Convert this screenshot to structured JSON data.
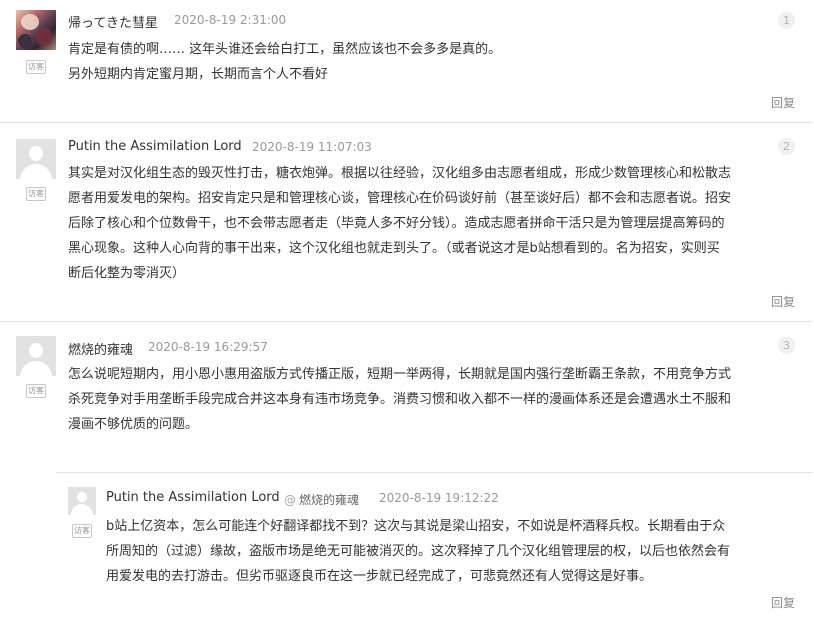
{
  "comments": [
    {
      "author": "帰ってきた彗星",
      "time": "2020-8-19 2:31:00",
      "floor": "1",
      "visitor_badge": "访客",
      "avatar": "anime-avatar-icon",
      "lines": [
        "肯定是有债的啊…… 这年头谁还会给白打工，虽然应该也不会多多是真的。",
        "另外短期内肯定蜜月期，长期而言个人不看好"
      ],
      "reply_label": "回复"
    },
    {
      "author": "Putin the Assimilation Lord",
      "time": "2020-8-19 11:07:03",
      "floor": "2",
      "visitor_badge": "访客",
      "avatar": "default-user-icon",
      "lines": [
        "其实是对汉化组生态的毁灭性打击，糖衣炮弹。根据以往经验，汉化组多由志愿者组成，形成少数管理核心和松散志",
        "愿者用爱发电的架构。招安肯定只是和管理核心谈，管理核心在价码谈好前（甚至谈好后）都不会和志愿者说。招安",
        "后除了核心和个位数骨干，也不会带志愿者走（毕竟人多不好分钱）。造成志愿者拼命干活只是为管理层提高筹码的",
        "黑心现象。这种人心向背的事干出来，这个汉化组也就走到头了。（或者说这才是b站想看到的。名为招安，实则买",
        "断后化整为零消灭）"
      ],
      "reply_label": "回复"
    },
    {
      "author": "燃烧的雍魂",
      "time": "2020-8-19 16:29:57",
      "floor": "3",
      "visitor_badge": "访客",
      "avatar": "default-user-icon",
      "lines": [
        "怎么说呢短期内，用小恩小惠用盗版方式传播正版，短期一举两得，长期就是国内强行垄断霸王条款，不用竞争方式",
        "杀死竞争对手用垄断手段完成合并这本身有违市场竞争。消费习惯和收入都不一样的漫画体系还是会遭遇水土不服和",
        "漫画不够优质的问题。"
      ],
      "reply": {
        "author": "Putin the Assimilation Lord",
        "reply_to_symbol": "@",
        "reply_to": "燃烧的雍魂",
        "time": "2020-8-19 19:12:22",
        "visitor_badge": "访客",
        "avatar": "default-user-icon",
        "lines": [
          "b站上亿资本，怎么可能连个好翻译都找不到？这次与其说是梁山招安，不如说是杯酒释兵权。长期看由于众",
          "所周知的（过滤）缘故，盗版市场是绝无可能被消灭的。这次释掉了几个汉化组管理层的权，以后也依然会有",
          "用爱发电的去打游击。但劣币驱逐良币在这一步就已经完成了，可悲竟然还有人觉得这是好事。"
        ],
        "reply_label": "回复"
      }
    }
  ]
}
